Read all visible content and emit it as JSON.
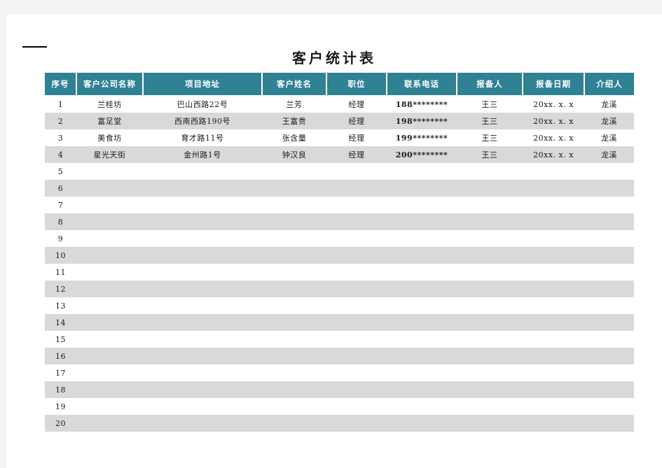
{
  "document": {
    "title": "客户统计表"
  },
  "table": {
    "columns": [
      {
        "key": "index",
        "label": "序号"
      },
      {
        "key": "company",
        "label": "客户公司名称"
      },
      {
        "key": "address",
        "label": "项目地址"
      },
      {
        "key": "customer",
        "label": "客户姓名"
      },
      {
        "key": "position",
        "label": "职位"
      },
      {
        "key": "phone",
        "label": "联系电话"
      },
      {
        "key": "reporter",
        "label": "报备人"
      },
      {
        "key": "date",
        "label": "报备日期"
      },
      {
        "key": "referrer",
        "label": "介绍人"
      }
    ],
    "rows": [
      {
        "index": "1",
        "company": "兰桂坊",
        "address": "巴山西路22号",
        "customer": "兰芳",
        "position": "经理",
        "phone": "188********",
        "reporter": "王三",
        "date": "20xx. x. x",
        "referrer": "龙溪"
      },
      {
        "index": "2",
        "company": "富足堂",
        "address": "西南西路190号",
        "customer": "王富贵",
        "position": "经理",
        "phone": "198********",
        "reporter": "王三",
        "date": "20xx. x. x",
        "referrer": "龙溪"
      },
      {
        "index": "3",
        "company": "美食坊",
        "address": "育才路11号",
        "customer": "张含量",
        "position": "经理",
        "phone": "199********",
        "reporter": "王三",
        "date": "20xx. x. x",
        "referrer": "龙溪"
      },
      {
        "index": "4",
        "company": "星光天街",
        "address": "金州路1号",
        "customer": "钟汉良",
        "position": "经理",
        "phone": "200********",
        "reporter": "王三",
        "date": "20xx. x. x",
        "referrer": "龙溪"
      },
      {
        "index": "5",
        "company": "",
        "address": "",
        "customer": "",
        "position": "",
        "phone": "",
        "reporter": "",
        "date": "",
        "referrer": ""
      },
      {
        "index": "6",
        "company": "",
        "address": "",
        "customer": "",
        "position": "",
        "phone": "",
        "reporter": "",
        "date": "",
        "referrer": ""
      },
      {
        "index": "7",
        "company": "",
        "address": "",
        "customer": "",
        "position": "",
        "phone": "",
        "reporter": "",
        "date": "",
        "referrer": ""
      },
      {
        "index": "8",
        "company": "",
        "address": "",
        "customer": "",
        "position": "",
        "phone": "",
        "reporter": "",
        "date": "",
        "referrer": ""
      },
      {
        "index": "9",
        "company": "",
        "address": "",
        "customer": "",
        "position": "",
        "phone": "",
        "reporter": "",
        "date": "",
        "referrer": ""
      },
      {
        "index": "10",
        "company": "",
        "address": "",
        "customer": "",
        "position": "",
        "phone": "",
        "reporter": "",
        "date": "",
        "referrer": ""
      },
      {
        "index": "11",
        "company": "",
        "address": "",
        "customer": "",
        "position": "",
        "phone": "",
        "reporter": "",
        "date": "",
        "referrer": ""
      },
      {
        "index": "12",
        "company": "",
        "address": "",
        "customer": "",
        "position": "",
        "phone": "",
        "reporter": "",
        "date": "",
        "referrer": ""
      },
      {
        "index": "13",
        "company": "",
        "address": "",
        "customer": "",
        "position": "",
        "phone": "",
        "reporter": "",
        "date": "",
        "referrer": ""
      },
      {
        "index": "14",
        "company": "",
        "address": "",
        "customer": "",
        "position": "",
        "phone": "",
        "reporter": "",
        "date": "",
        "referrer": ""
      },
      {
        "index": "15",
        "company": "",
        "address": "",
        "customer": "",
        "position": "",
        "phone": "",
        "reporter": "",
        "date": "",
        "referrer": ""
      },
      {
        "index": "16",
        "company": "",
        "address": "",
        "customer": "",
        "position": "",
        "phone": "",
        "reporter": "",
        "date": "",
        "referrer": ""
      },
      {
        "index": "17",
        "company": "",
        "address": "",
        "customer": "",
        "position": "",
        "phone": "",
        "reporter": "",
        "date": "",
        "referrer": ""
      },
      {
        "index": "18",
        "company": "",
        "address": "",
        "customer": "",
        "position": "",
        "phone": "",
        "reporter": "",
        "date": "",
        "referrer": ""
      },
      {
        "index": "19",
        "company": "",
        "address": "",
        "customer": "",
        "position": "",
        "phone": "",
        "reporter": "",
        "date": "",
        "referrer": ""
      },
      {
        "index": "20",
        "company": "",
        "address": "",
        "customer": "",
        "position": "",
        "phone": "",
        "reporter": "",
        "date": "",
        "referrer": ""
      }
    ]
  },
  "colors": {
    "header_background": "#2f8194",
    "header_text": "#ffffff",
    "row_band": "#d9d9d9",
    "row_plain": "#ffffff",
    "page_background": "#f3f3f3",
    "sheet_background": "#ffffff",
    "rule": "#000000"
  }
}
